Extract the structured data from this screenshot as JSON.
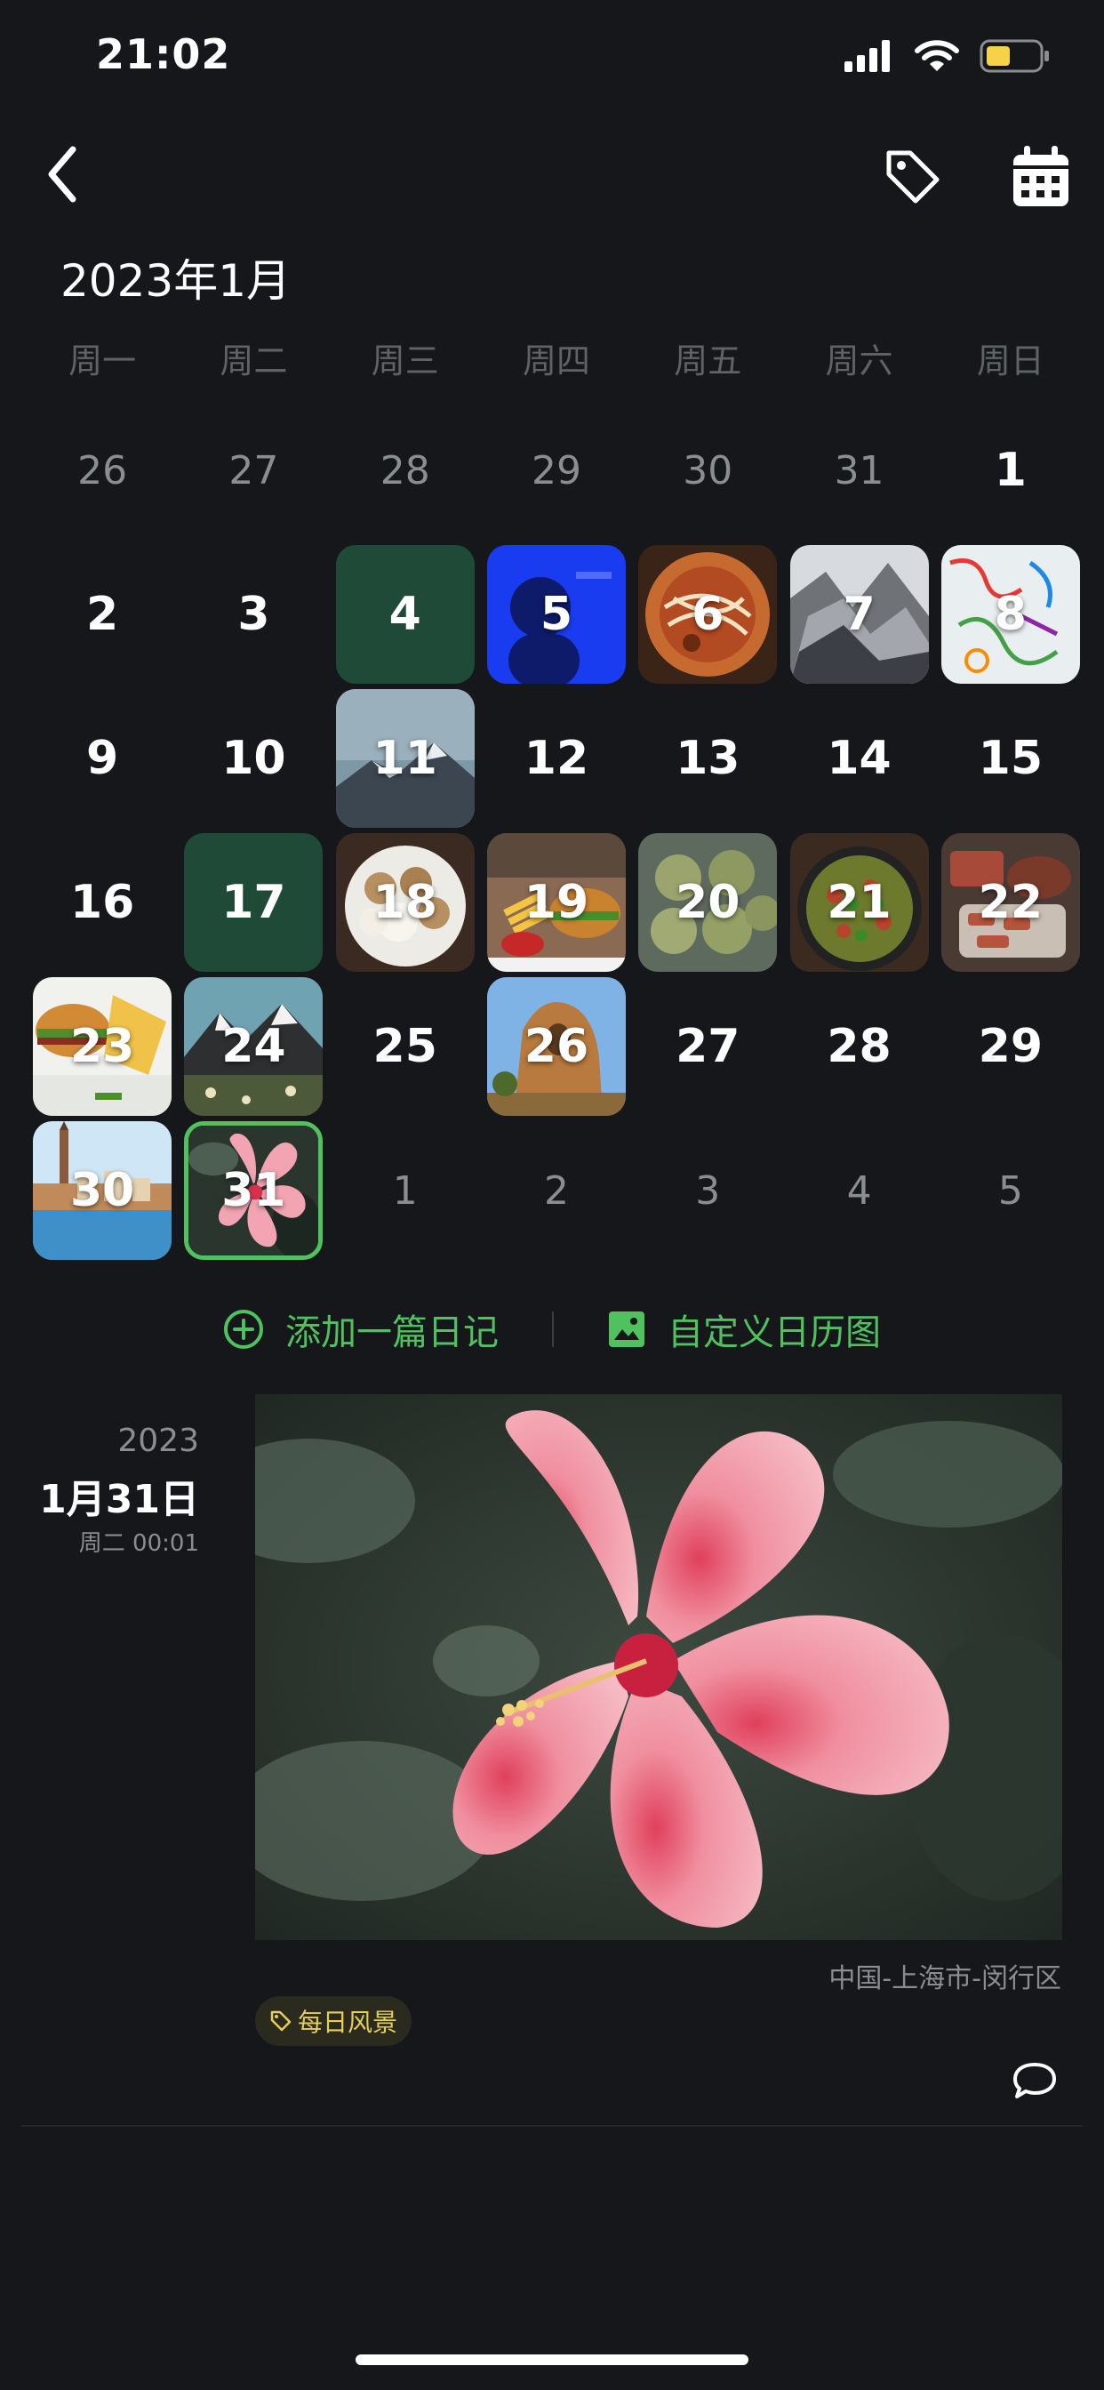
{
  "status": {
    "time": "21:02"
  },
  "month_title": "2023年1月",
  "weekdays": [
    "周一",
    "周二",
    "周三",
    "周四",
    "周五",
    "周六",
    "周日"
  ],
  "calendar": [
    {
      "label": "26",
      "type": "other"
    },
    {
      "label": "27",
      "type": "other"
    },
    {
      "label": "28",
      "type": "other"
    },
    {
      "label": "29",
      "type": "other"
    },
    {
      "label": "30",
      "type": "other"
    },
    {
      "label": "31",
      "type": "other"
    },
    {
      "label": "1",
      "type": "plain"
    },
    {
      "label": "2",
      "type": "plain"
    },
    {
      "label": "3",
      "type": "plain"
    },
    {
      "label": "4",
      "type": "green"
    },
    {
      "label": "5",
      "type": "photo",
      "photo": "blue-silhouette"
    },
    {
      "label": "6",
      "type": "photo",
      "photo": "noodles"
    },
    {
      "label": "7",
      "type": "photo",
      "photo": "snow-mountain"
    },
    {
      "label": "8",
      "type": "photo",
      "photo": "doodle-art"
    },
    {
      "label": "9",
      "type": "plain"
    },
    {
      "label": "10",
      "type": "plain"
    },
    {
      "label": "11",
      "type": "photo",
      "photo": "mountain-sky"
    },
    {
      "label": "12",
      "type": "plain"
    },
    {
      "label": "13",
      "type": "plain"
    },
    {
      "label": "14",
      "type": "plain"
    },
    {
      "label": "15",
      "type": "plain"
    },
    {
      "label": "16",
      "type": "plain"
    },
    {
      "label": "17",
      "type": "green"
    },
    {
      "label": "18",
      "type": "photo",
      "photo": "dumplings"
    },
    {
      "label": "19",
      "type": "photo",
      "photo": "burger-fries"
    },
    {
      "label": "20",
      "type": "photo",
      "photo": "green-balls"
    },
    {
      "label": "21",
      "type": "photo",
      "photo": "stir-fry"
    },
    {
      "label": "22",
      "type": "photo",
      "photo": "bbq"
    },
    {
      "label": "23",
      "type": "photo",
      "photo": "burger-box"
    },
    {
      "label": "24",
      "type": "photo",
      "photo": "alpine"
    },
    {
      "label": "25",
      "type": "plain"
    },
    {
      "label": "26",
      "type": "photo",
      "photo": "rock"
    },
    {
      "label": "27",
      "type": "plain"
    },
    {
      "label": "28",
      "type": "plain"
    },
    {
      "label": "29",
      "type": "plain"
    },
    {
      "label": "30",
      "type": "photo",
      "photo": "venice"
    },
    {
      "label": "31",
      "type": "photo",
      "photo": "hibiscus",
      "selected": true
    },
    {
      "label": "1",
      "type": "other"
    },
    {
      "label": "2",
      "type": "other"
    },
    {
      "label": "3",
      "type": "other"
    },
    {
      "label": "4",
      "type": "other"
    },
    {
      "label": "5",
      "type": "other"
    }
  ],
  "actions": {
    "add_diary": "添加一篇日记",
    "custom_calendar_image": "自定义日历图"
  },
  "entry": {
    "year": "2023",
    "date": "1月31日",
    "weekday_time": "周二 00:01",
    "photo": "hibiscus",
    "location": "中国-上海市-闵行区",
    "tag": "每日风景"
  },
  "colors": {
    "accent": "#4fc25f",
    "green_day": "#1f4a38",
    "tag_text": "#e6cf55",
    "background": "#15171a"
  }
}
